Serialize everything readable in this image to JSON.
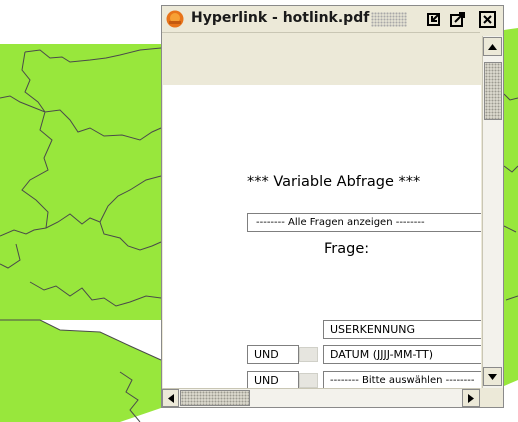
{
  "map": {
    "land_color": "#98e73c",
    "border_color": "#4a4a4a"
  },
  "window": {
    "title": "Hyperlink - hotlink.pdf",
    "app_icon": "pdf-app-icon",
    "buttons": [
      "restore-icon",
      "maximize-icon",
      "close-icon"
    ]
  },
  "form": {
    "heading": "*** Variable Abfrage ***",
    "show_all": "-------- Alle Fragen anzeigen --------",
    "question_label": "Frage:",
    "rows": [
      {
        "operator": "",
        "field": "USERKENNUNG"
      },
      {
        "operator": "UND",
        "field": "DATUM (JJJJ-MM-TT)"
      },
      {
        "operator": "UND",
        "field": "-------- Bitte auswählen --------"
      }
    ]
  }
}
